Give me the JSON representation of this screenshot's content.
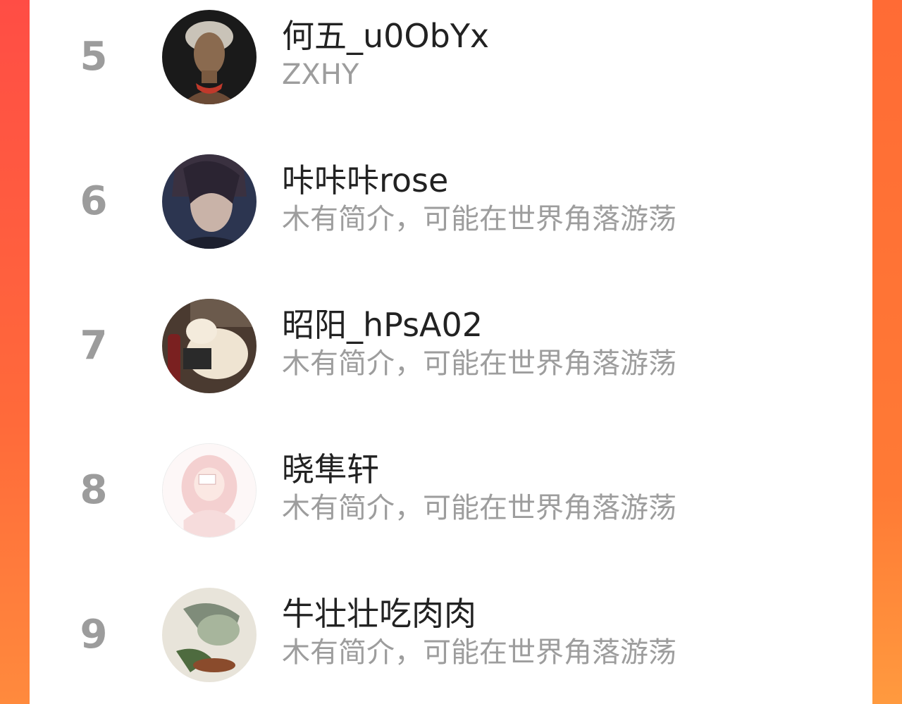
{
  "leaderboard": {
    "rows": [
      {
        "rank": "5",
        "username": "何五_u0ObYx",
        "bio": "ZXHY",
        "avatar_icon": "avatar-portrait-icon",
        "accent": "#c0392b"
      },
      {
        "rank": "6",
        "username": "咔咔咔rose",
        "bio": "木有简介，可能在世界角落游荡",
        "avatar_icon": "avatar-game-character-icon",
        "accent": "#2c3e6b"
      },
      {
        "rank": "7",
        "username": "昭阳_hPsA02",
        "bio": "木有简介，可能在世界角落游荡",
        "avatar_icon": "avatar-cat-photo-icon",
        "accent": "#e8d9c0"
      },
      {
        "rank": "8",
        "username": "晓隼轩",
        "bio": "木有简介，可能在世界角落游荡",
        "avatar_icon": "avatar-anime-girl-icon",
        "accent": "#f2c6c6"
      },
      {
        "rank": "9",
        "username": "牛壮壮吃肉肉",
        "bio": "木有简介，可能在世界角落游荡",
        "avatar_icon": "avatar-ink-painting-icon",
        "accent": "#6b8a5a"
      }
    ]
  },
  "colors": {
    "background_top": "#ff4d45",
    "background_bottom": "#ff8a3d",
    "rank_text": "#9c9c9c",
    "username_text": "#222222",
    "bio_text": "#9d9d9d"
  }
}
